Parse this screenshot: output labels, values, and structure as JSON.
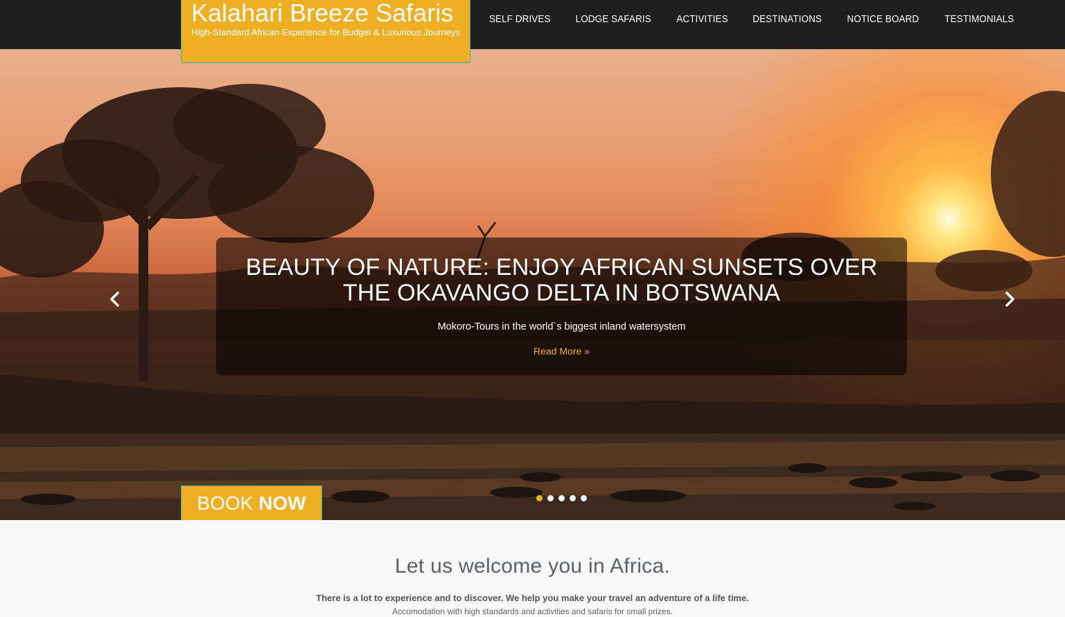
{
  "header": {
    "brand_title": "Kalahari Breeze Safaris",
    "brand_tagline": "High-Standard African Experience for Budget & Luxurious Journeys",
    "nav": [
      {
        "label": "SELF DRIVES"
      },
      {
        "label": "LODGE SAFARIS"
      },
      {
        "label": "ACTIVITIES"
      },
      {
        "label": "DESTINATIONS"
      },
      {
        "label": "NOTICE BOARD"
      },
      {
        "label": "TESTIMONIALS"
      }
    ]
  },
  "slider": {
    "title": "BEAUTY OF NATURE: ENJOY AFRICAN SUNSETS OVER THE OKAVANGO DELTA IN BOTSWANA",
    "text": "Mokoro-Tours in the world`s biggest inland watersystem",
    "link": "Read More »",
    "prev_icon": "chevron-left-icon",
    "next_icon": "chevron-right-icon",
    "slide_count": 5,
    "active_slide": 1
  },
  "book": {
    "part1": "BOOK",
    "part2": "NOW"
  },
  "welcome": {
    "title": "Let us welcome you in Africa.",
    "text": "There is a lot to experience and to discover. We help you make your travel an adventure of a life time.",
    "text2": "Accomodation with high standards and activities and safaris for small prizes."
  },
  "colors": {
    "accent": "#eeb022",
    "topbar": "#1f1f1f",
    "brand_border": "#2bb3a8"
  }
}
